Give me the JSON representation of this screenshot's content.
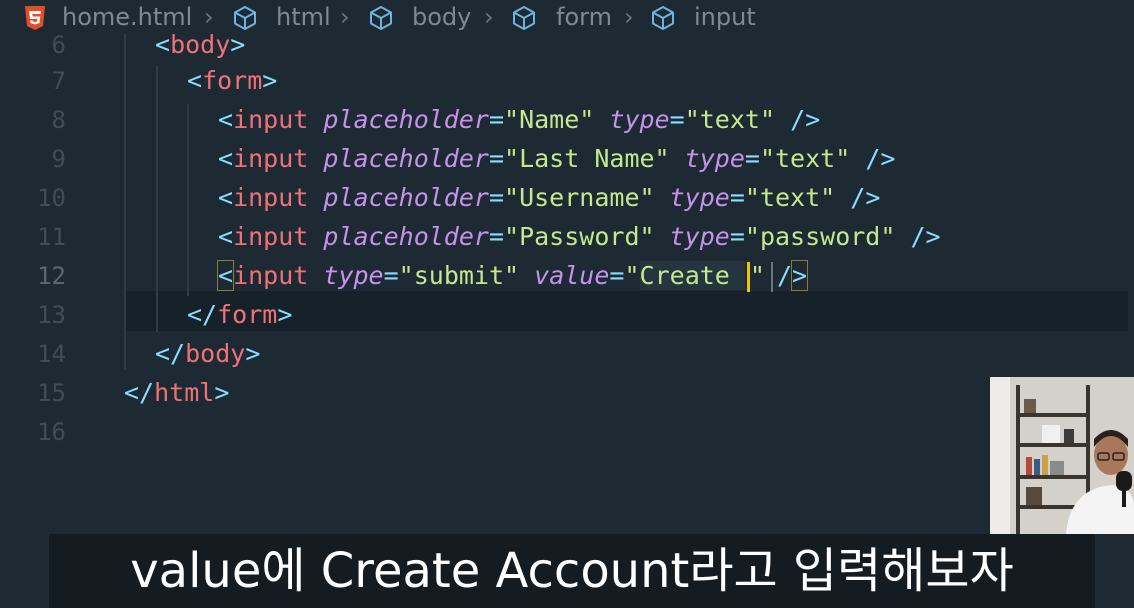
{
  "breadcrumb": {
    "file": "home.html",
    "path": [
      "html",
      "body",
      "form",
      "input"
    ]
  },
  "gutter": [
    "6",
    "7",
    "8",
    "9",
    "10",
    "11",
    "12",
    "13",
    "14",
    "15",
    "16"
  ],
  "code": {
    "body_open": "body",
    "form_open": "form",
    "inputs": [
      {
        "tag": "input",
        "attr1": "placeholder",
        "val1": "\"Name\"",
        "attr2": "type",
        "val2": "\"text\""
      },
      {
        "tag": "input",
        "attr1": "placeholder",
        "val1": "\"Last Name\"",
        "attr2": "type",
        "val2": "\"text\""
      },
      {
        "tag": "input",
        "attr1": "placeholder",
        "val1": "\"Username\"",
        "attr2": "type",
        "val2": "\"text\""
      },
      {
        "tag": "input",
        "attr1": "placeholder",
        "val1": "\"Password\"",
        "attr2": "type",
        "val2": "\"password\""
      }
    ],
    "submit_line": {
      "tag": "input",
      "attr1": "type",
      "val1": "\"submit\"",
      "attr2": "value",
      "val2_open": "\"",
      "val2_text": "Create ",
      "val2_close": "\""
    },
    "form_close": "form",
    "body_close": "body",
    "html_close": "html"
  },
  "subtitle": "value에 Create Account라고 입력해보자",
  "colors": {
    "background": "#1e2a33",
    "tag": "#f07178",
    "attribute": "#c792ea",
    "string": "#c3e88d",
    "punctuation": "#89ddff",
    "cursor": "#f5c400"
  },
  "icons": {
    "file_icon": "html5-icon",
    "path_icon": "cube-icon"
  }
}
